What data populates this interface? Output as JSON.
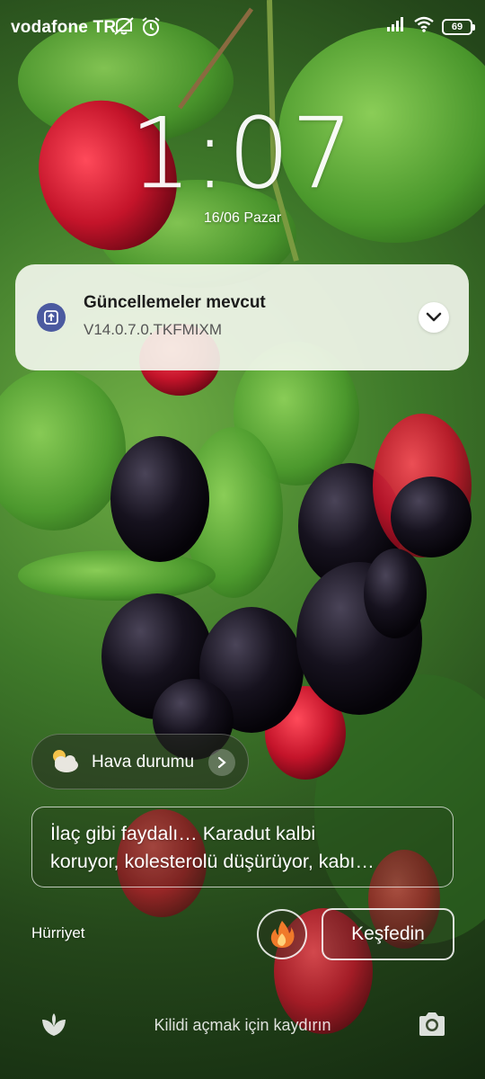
{
  "status_bar": {
    "carrier": "vodafone TR",
    "battery": "69",
    "icons": [
      "mute-icon",
      "alarm-icon",
      "signal-icon",
      "wifi-icon",
      "battery-icon"
    ]
  },
  "lock": {
    "time": "1:07",
    "date": "16/06 Pazar"
  },
  "notification": {
    "app_icon": "update-icon",
    "title": "Güncellemeler mevcut",
    "text": "V14.0.7.0.TKFMIXM",
    "expand_icon": "chevron-down-icon"
  },
  "weather": {
    "label": "Hava durumu",
    "icon": "cloudy-icon"
  },
  "news": {
    "line1": "İlaç gibi faydalı… Karadut kalbi",
    "line2": "koruyor, kolesterolü düşürüyor, kabı…",
    "source": "Hürriyet",
    "discover_label": "Keşfedin",
    "fire_icon": "fire-icon"
  },
  "bottom": {
    "hint": "Kilidi açmak için kaydırın",
    "left_icon": "leaf-icon",
    "right_icon": "camera-icon"
  }
}
